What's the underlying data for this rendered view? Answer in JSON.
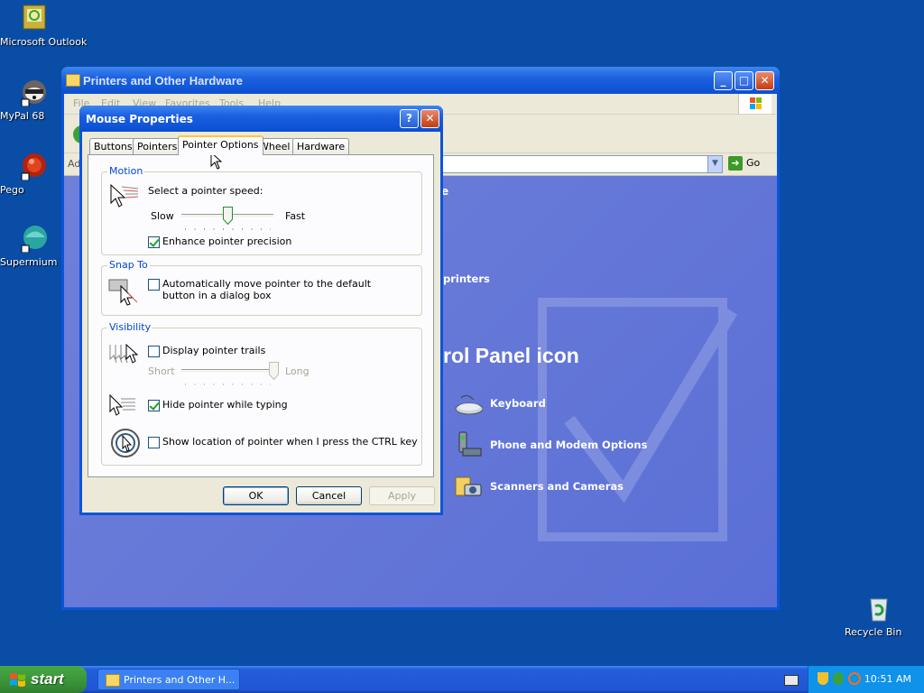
{
  "desktop": {
    "icons": [
      {
        "label": "Microsoft Outlook"
      },
      {
        "label": "MyPal 68"
      },
      {
        "label": "Pego"
      },
      {
        "label": "Supermium"
      },
      {
        "label": "Recycle Bin"
      }
    ]
  },
  "explorer": {
    "title": "Printers and Other Hardware",
    "menu": [
      "File",
      "Edit",
      "View",
      "Favorites",
      "Tools",
      "Help"
    ],
    "address_label": "Ad",
    "go_label": "Go",
    "partial_texts": [
      "e",
      "printers"
    ],
    "heading": "rol Panel icon",
    "items": [
      {
        "label": "Keyboard",
        "icon": "keyboard-icon"
      },
      {
        "label": "Phone and Modem Options",
        "icon": "phone-modem-icon"
      },
      {
        "label": "Scanners and Cameras",
        "icon": "scanner-camera-icon"
      }
    ]
  },
  "dialog": {
    "title": "Mouse Properties",
    "help_button": "?",
    "tabs": [
      "Buttons",
      "Pointers",
      "Pointer Options",
      "Wheel",
      "Hardware"
    ],
    "active_tab": "Pointer Options",
    "motion": {
      "group_title": "Motion",
      "prompt": "Select a pointer speed:",
      "slow_label": "Slow",
      "fast_label": "Fast",
      "speed_level": 0.5,
      "precision_label": "Enhance pointer precision",
      "precision_checked": true
    },
    "snap_to": {
      "group_title": "Snap To",
      "label": "Automatically move pointer to the default button in a dialog box",
      "checked": false
    },
    "visibility": {
      "group_title": "Visibility",
      "trails_label": "Display pointer trails",
      "trails_checked": false,
      "short_label": "Short",
      "long_label": "Long",
      "trail_level": 1.0,
      "hide_label": "Hide pointer while typing",
      "hide_checked": true,
      "show_location_label": "Show location of pointer when I press the CTRL key",
      "show_location_checked": false
    },
    "buttons": {
      "ok": "OK",
      "cancel": "Cancel",
      "apply": "Apply"
    }
  },
  "taskbar": {
    "start_label": "start",
    "task_item": "Printers and Other H...",
    "clock": "10:51 AM"
  },
  "colors": {
    "desktop": "#0a4da6",
    "titlebar": "#0b4fd1",
    "content_panel": "#5a6fd6",
    "tray": "#0f92e9",
    "start_green": "#3c973a"
  }
}
